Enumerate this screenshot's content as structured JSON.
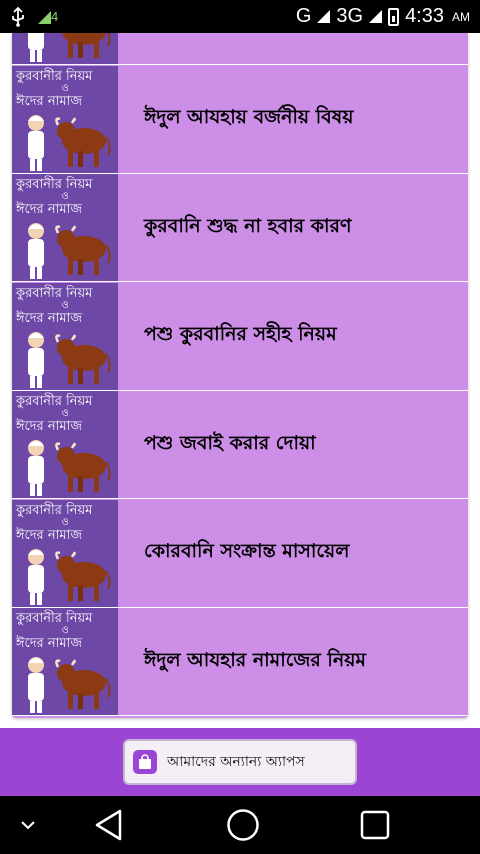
{
  "status_bar": {
    "network_g": "G",
    "network_3g": "3G",
    "time": "4:33",
    "ampm": "AM",
    "badge": "4"
  },
  "thumbnail": {
    "line1": "কুরবানীর নিয়ম",
    "and": "ও",
    "line2": "ঈদের নামাজ"
  },
  "list": {
    "items": [
      {
        "label": ""
      },
      {
        "label": "ঈদুল আযহায় বর্জনীয় বিষয়"
      },
      {
        "label": "কুরবানি শুদ্ধ না হবার কারণ"
      },
      {
        "label": "পশু কুরবানির সহীহ নিয়ম"
      },
      {
        "label": "পশু জবাই করার দোয়া"
      },
      {
        "label": "কোরবানি সংক্রান্ত মাসায়েল"
      },
      {
        "label": "ঈদুল আযহার নামাজের নিয়ম"
      }
    ]
  },
  "footer": {
    "apps_button_label": "আমাদের অন্যান্য অ্যাপস"
  },
  "colors": {
    "list_bg": "#cc8ee6",
    "thumb_bg": "#6d48a6",
    "action_bar": "#9a45d4"
  }
}
